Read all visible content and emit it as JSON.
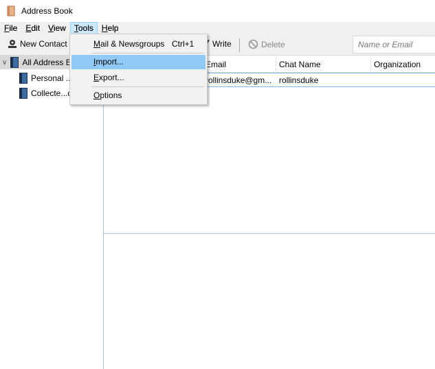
{
  "window": {
    "title": "Address Book",
    "icon": "address-book-icon"
  },
  "menubar": [
    {
      "label": "File",
      "u": "F",
      "rest": "ile"
    },
    {
      "label": "Edit",
      "u": "E",
      "rest": "dit"
    },
    {
      "label": "View",
      "u": "V",
      "rest": "iew"
    },
    {
      "label": "Tools",
      "u": "T",
      "rest": "ools"
    },
    {
      "label": "Help",
      "u": "H",
      "rest": "elp"
    }
  ],
  "toolbar": {
    "new_contact": "New Contact",
    "write": "Write",
    "delete": "Delete",
    "search_placeholder": "Name or Email"
  },
  "sidebar": {
    "items": [
      {
        "label": "All Address B"
      },
      {
        "label": "Personal ..."
      },
      {
        "label": "Collecte...d"
      }
    ]
  },
  "list": {
    "columns": [
      "Email",
      "Chat Name",
      "Organization"
    ],
    "rows": [
      {
        "email": "rollinsduke@gm...",
        "chat": "rollinsduke",
        "org": ""
      }
    ]
  },
  "tools_menu": {
    "items": [
      {
        "u": "M",
        "rest": "ail & Newsgroups",
        "shortcut": "Ctrl+1"
      },
      {
        "u": "I",
        "rest": "mport..."
      },
      {
        "u": "E",
        "rest": "xport..."
      },
      {
        "u": "O",
        "rest": "ptions"
      }
    ],
    "highlighted": "Import..."
  },
  "colors": {
    "highlight": "#91c9f7",
    "menu_open": "#cce8ff",
    "row_border": "#7ab8ee"
  }
}
